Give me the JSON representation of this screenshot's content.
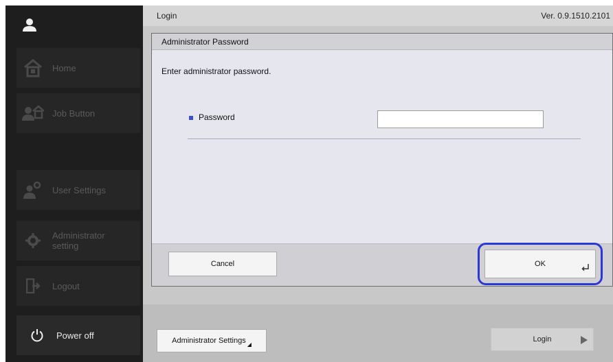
{
  "topbar": {
    "title": "Login",
    "version": "Ver. 0.9.1510.2101"
  },
  "sidebar": {
    "items": [
      {
        "label": "Home",
        "icon": "home-icon",
        "enabled": false
      },
      {
        "label": "Job Button",
        "icon": "job-button-icon",
        "enabled": false
      },
      {
        "label": "User Settings",
        "icon": "user-settings-icon",
        "enabled": false
      },
      {
        "label": "Administrator setting",
        "icon": "gear-icon",
        "enabled": false
      },
      {
        "label": "Logout",
        "icon": "logout-icon",
        "enabled": false
      }
    ],
    "power": {
      "label": "Power off",
      "icon": "power-icon"
    }
  },
  "dialog": {
    "title": "Administrator Password",
    "message": "Enter administrator password.",
    "field_label": "Password",
    "field_value": "",
    "cancel_label": "Cancel",
    "ok_label": "OK"
  },
  "footer": {
    "admin_settings_label": "Administrator Settings",
    "login_label": "Login"
  },
  "colors": {
    "focus_ring": "#2c38d6",
    "bullet": "#3b4fd1",
    "sidebar_bg": "#1e1e1e"
  }
}
